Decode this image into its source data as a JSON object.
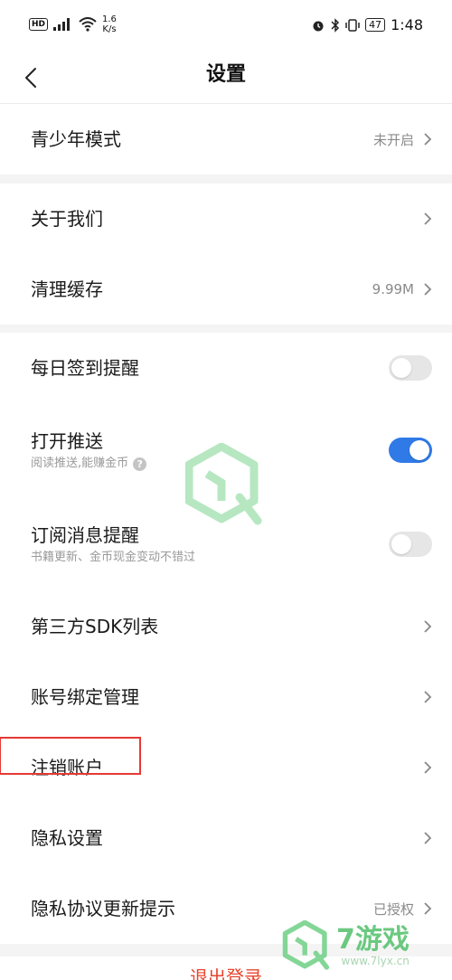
{
  "status_bar": {
    "hd": "HD",
    "net_speed_value": "1.6",
    "net_speed_unit": "K/s",
    "battery": "47",
    "time": "1:48"
  },
  "header": {
    "title": "设置"
  },
  "settings": {
    "teen_mode": {
      "label": "青少年模式",
      "value": "未开启"
    },
    "about_us": {
      "label": "关于我们"
    },
    "clear_cache": {
      "label": "清理缓存",
      "value": "9.99M"
    },
    "daily_checkin": {
      "label": "每日签到提醒",
      "enabled": false
    },
    "push": {
      "label": "打开推送",
      "sub": "阅读推送,能赚金币",
      "help": "?",
      "enabled": true
    },
    "subscription": {
      "label": "订阅消息提醒",
      "sub": "书籍更新、金币现金变动不错过",
      "enabled": false
    },
    "third_party_sdk": {
      "label": "第三方SDK列表"
    },
    "account_binding": {
      "label": "账号绑定管理"
    },
    "cancel_account": {
      "label": "注销账户"
    },
    "privacy_settings": {
      "label": "隐私设置"
    },
    "privacy_update": {
      "label": "隐私协议更新提示",
      "value": "已授权"
    }
  },
  "logout_label": "退出登录",
  "watermark": {
    "title": "7游戏",
    "site": "www.7lyx.cn"
  },
  "colors": {
    "accent": "#2f7ae6",
    "toggle_off": "#e6e6e6",
    "highlight": "#e53935",
    "logout": "#e8452f",
    "watermark": "#52c06b"
  }
}
